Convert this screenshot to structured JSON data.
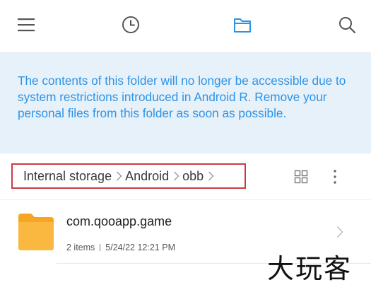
{
  "toolbar": {
    "icons": [
      "menu-icon",
      "clock-icon",
      "folder-icon",
      "search-icon"
    ],
    "active_tab": "folder",
    "accent_color": "#2d93e6"
  },
  "notice": {
    "text": "The contents of this folder will no longer be accessible due to system restrictions introduced in Android R. Remove your personal files from this folder as soon as possible.",
    "background": "#e7f1fa",
    "text_color": "#2d93e6"
  },
  "breadcrumb": {
    "items": [
      "Internal storage",
      "Android",
      "obb"
    ],
    "highlight_color": "#cc3b43"
  },
  "files": [
    {
      "name": "com.qooapp.game",
      "items": "2 items",
      "date": "5/24/22 12:21 PM",
      "icon": "folder-icon",
      "icon_color": "#fbb840"
    }
  ],
  "watermark": "大玩客"
}
